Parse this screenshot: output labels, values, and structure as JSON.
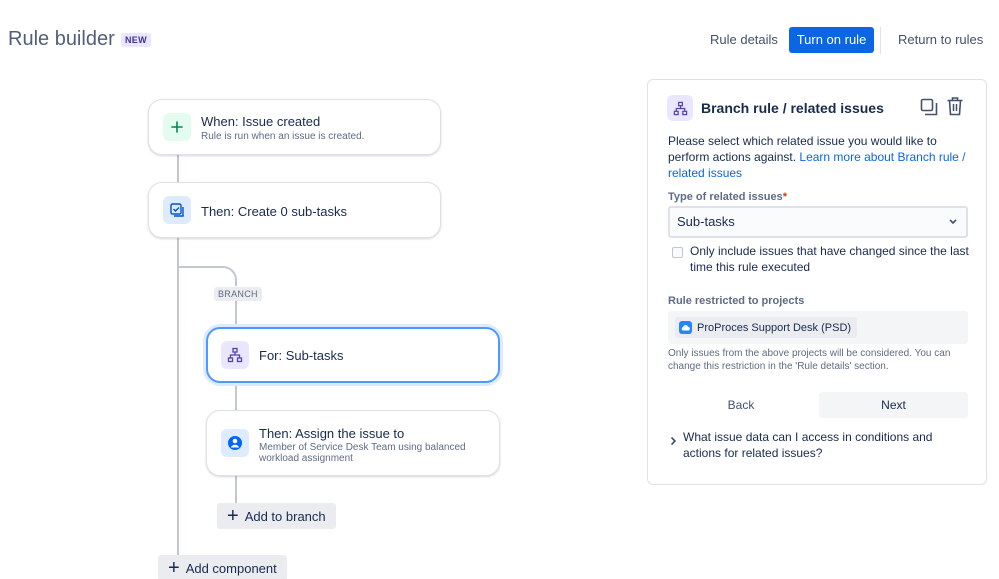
{
  "header": {
    "title": "Rule builder",
    "badge": "NEW",
    "rule_details": "Rule details",
    "turn_on": "Turn on rule",
    "return": "Return to rules"
  },
  "flow": {
    "trigger": {
      "title": "When: Issue created",
      "subtitle": "Rule is run when an issue is created.",
      "icon": "plus-icon"
    },
    "action1": {
      "title": "Then: Create 0 sub-tasks",
      "icon": "subtask-icon"
    },
    "branch_tag": "BRANCH",
    "branch": {
      "title": "For: Sub-tasks",
      "icon": "branch-icon"
    },
    "action2": {
      "title": "Then: Assign the issue to",
      "subtitle": "Member of Service Desk Team using balanced workload assignment",
      "icon": "user-icon"
    },
    "add_to_branch": "Add to branch",
    "add_component": "Add component"
  },
  "panel": {
    "title": "Branch rule / related issues",
    "description": "Please select which related issue you would like to perform actions against. ",
    "learn_more": "Learn more about Branch rule / related issues",
    "type_label": "Type of related issues",
    "required_mark": "*",
    "type_value": "Sub-tasks",
    "checkbox_label": "Only include issues that have changed since the last time this rule executed",
    "projects_label": "Rule restricted to projects",
    "project_chip": "ProProces Support Desk (PSD)",
    "projects_note": "Only issues from the above projects will be considered. You can change this restriction in the 'Rule details' section.",
    "back": "Back",
    "next": "Next",
    "faq": "What issue data can I access in conditions and actions for related issues?"
  },
  "colors": {
    "primary": "#0c66e4",
    "badge_bg": "#eae6ff",
    "selected_border": "#4c9aff"
  }
}
